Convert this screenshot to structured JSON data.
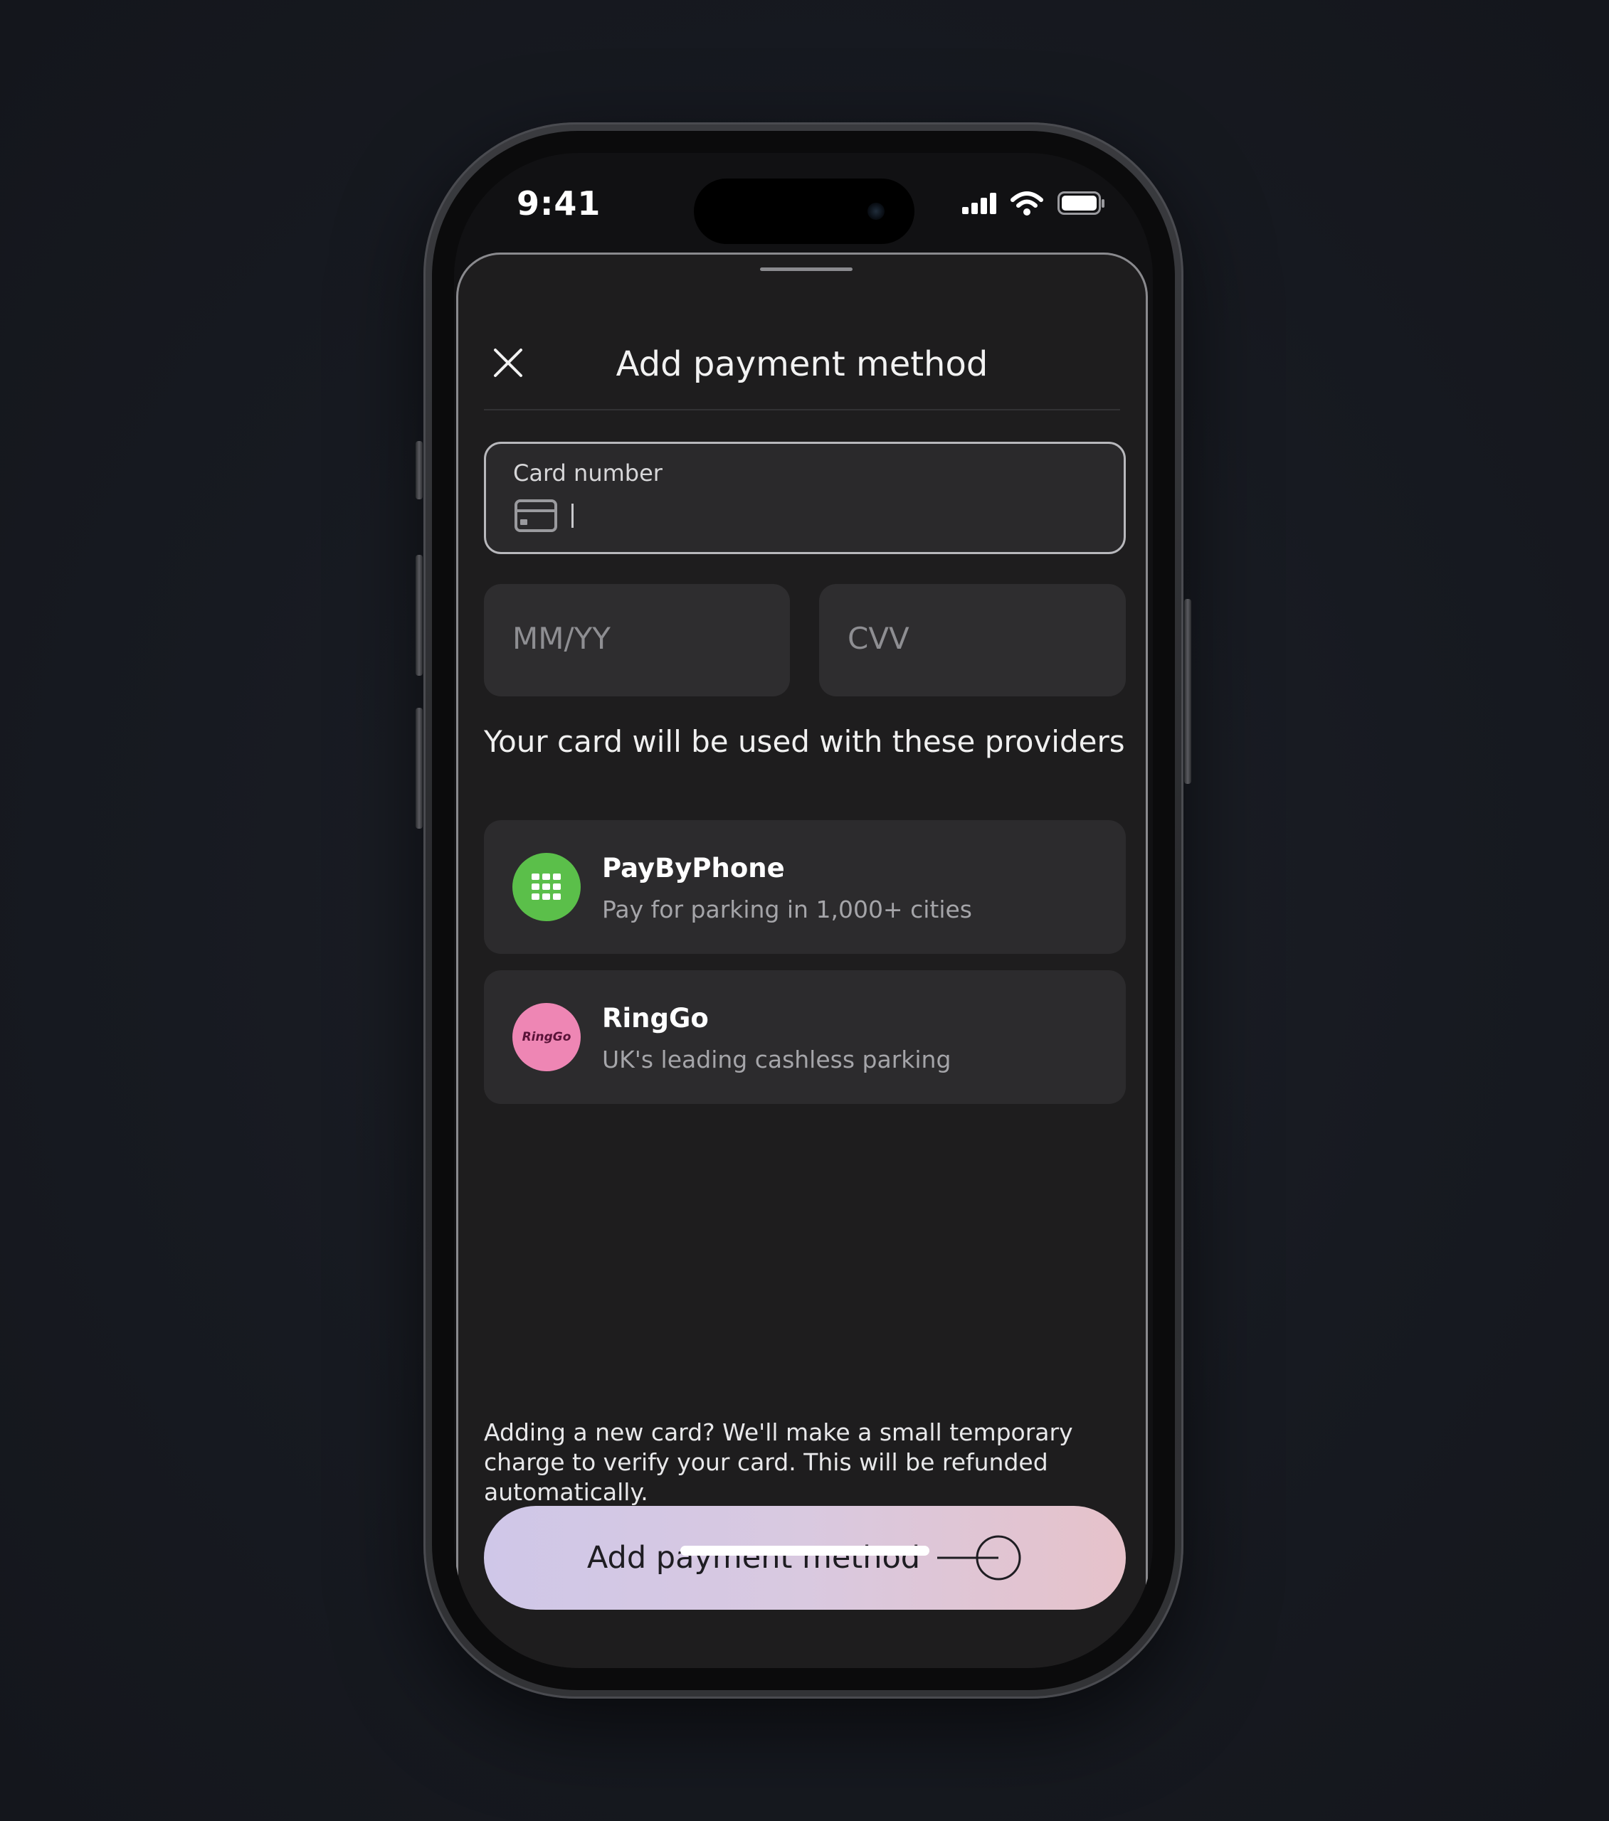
{
  "status_bar": {
    "time": "9:41",
    "signal_icon": "signal-bars-icon",
    "wifi_icon": "wifi-icon",
    "battery_icon": "battery-icon"
  },
  "sheet": {
    "title": "Add payment method",
    "close_icon": "close-icon"
  },
  "form": {
    "card_number_label": "Card number",
    "card_number_value": "",
    "card_icon": "credit-card-icon",
    "expiry_placeholder": "MM/YY",
    "cvv_placeholder": "CVV"
  },
  "providers": {
    "heading": "Your card will be used with these providers",
    "items": [
      {
        "name": "PayByPhone",
        "description": "Pay for parking in 1,000+ cities",
        "logo_color": "#5bbf4a",
        "logo_icon": "keypad-grid-icon"
      },
      {
        "name": "RingGo",
        "description": "UK's leading cashless parking",
        "logo_color": "#ee86b4",
        "logo_text": "RingGo"
      }
    ]
  },
  "notice": "Adding a new card? We'll make a small temporary charge to verify your card. This will be refunded automatically.",
  "cta": {
    "label": "Add payment method",
    "icon": "arrow-circle-icon"
  }
}
